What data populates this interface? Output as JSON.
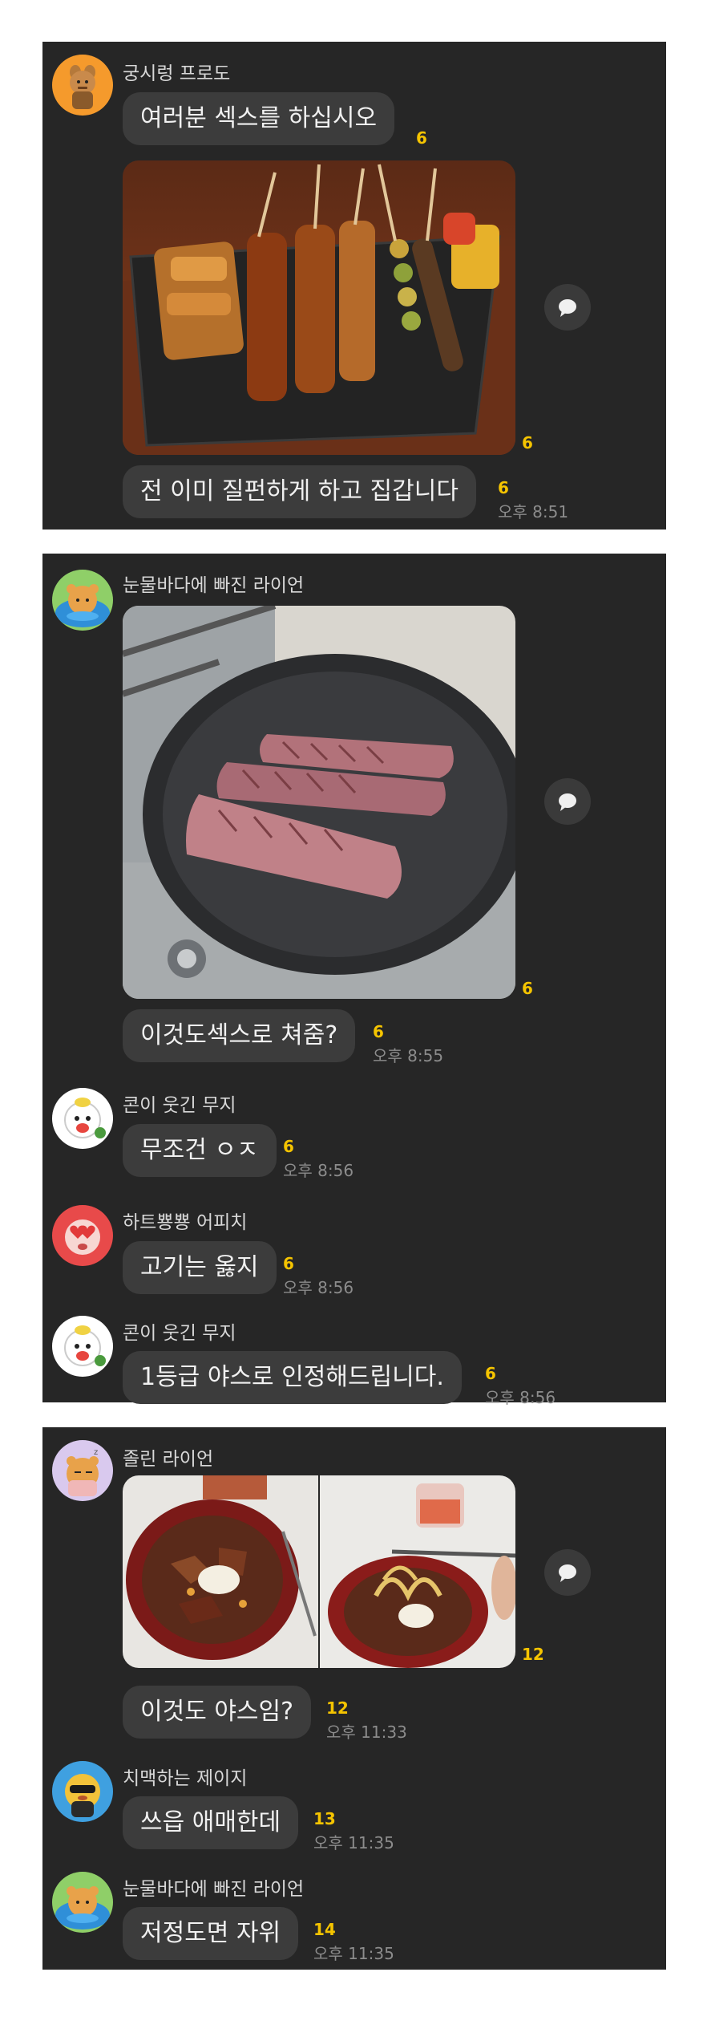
{
  "panels": [
    {
      "messages": [
        {
          "sender": "궁시렁 프로도",
          "avatar_icon": "frodo-avatar-icon",
          "items": [
            {
              "text": "여러분 섹스를 하십시오",
              "unread": "6"
            },
            {
              "image": "grilled-skewers-photo",
              "unread": "6"
            },
            {
              "text": "전 이미 질펀하게 하고 집갑니다",
              "unread": "6",
              "time": "오후 8:51"
            }
          ]
        }
      ]
    },
    {
      "messages": [
        {
          "sender": "눈물바다에 빠진 라이언",
          "avatar_icon": "ryan-avatar-icon",
          "items": [
            {
              "image": "beef-in-pan-photo",
              "unread": "6"
            },
            {
              "text": "이것도섹스로 쳐줌?",
              "unread": "6",
              "time": "오후 8:55"
            }
          ]
        },
        {
          "sender": "콘이 웃긴 무지",
          "avatar_icon": "muzi-avatar-icon",
          "items": [
            {
              "text": "무조건 ㅇㅈ",
              "unread": "6",
              "time": "오후 8:56"
            }
          ]
        },
        {
          "sender": "하트뿅뿅 어피치",
          "avatar_icon": "apeach-avatar-icon",
          "items": [
            {
              "text": "고기는 옳지",
              "unread": "6",
              "time": "오후 8:56"
            }
          ]
        },
        {
          "sender": "콘이 웃긴 무지",
          "avatar_icon": "muzi-avatar-icon",
          "items": [
            {
              "text": "1등급 야스로 인정해드립니다.",
              "unread": "6",
              "time": "오후 8:56"
            }
          ]
        }
      ]
    },
    {
      "messages": [
        {
          "sender": "졸린 라이언",
          "avatar_icon": "sleepy-ryan-avatar-icon",
          "items": [
            {
              "images": [
                "stir-fry-bowl-photo",
                "ramen-bowl-photo"
              ],
              "unread": "12"
            },
            {
              "text": "이것도 야스임?",
              "unread": "12",
              "time": "오후 11:33"
            }
          ]
        },
        {
          "sender": "치맥하는 제이지",
          "avatar_icon": "jayg-avatar-icon",
          "items": [
            {
              "text": "쓰읍 애매한데",
              "unread": "13",
              "time": "오후 11:35"
            }
          ]
        },
        {
          "sender": "눈물바다에 빠진 라이언",
          "avatar_icon": "ryan-avatar-icon",
          "items": [
            {
              "text": "저정도면 자위",
              "unread": "14",
              "time": "오후 11:35"
            }
          ]
        }
      ]
    }
  ],
  "colors": {
    "panel_bg": "#262626",
    "bubble_bg": "#3c3c3c",
    "unread": "#f5c400",
    "time": "#8c8c8c"
  }
}
